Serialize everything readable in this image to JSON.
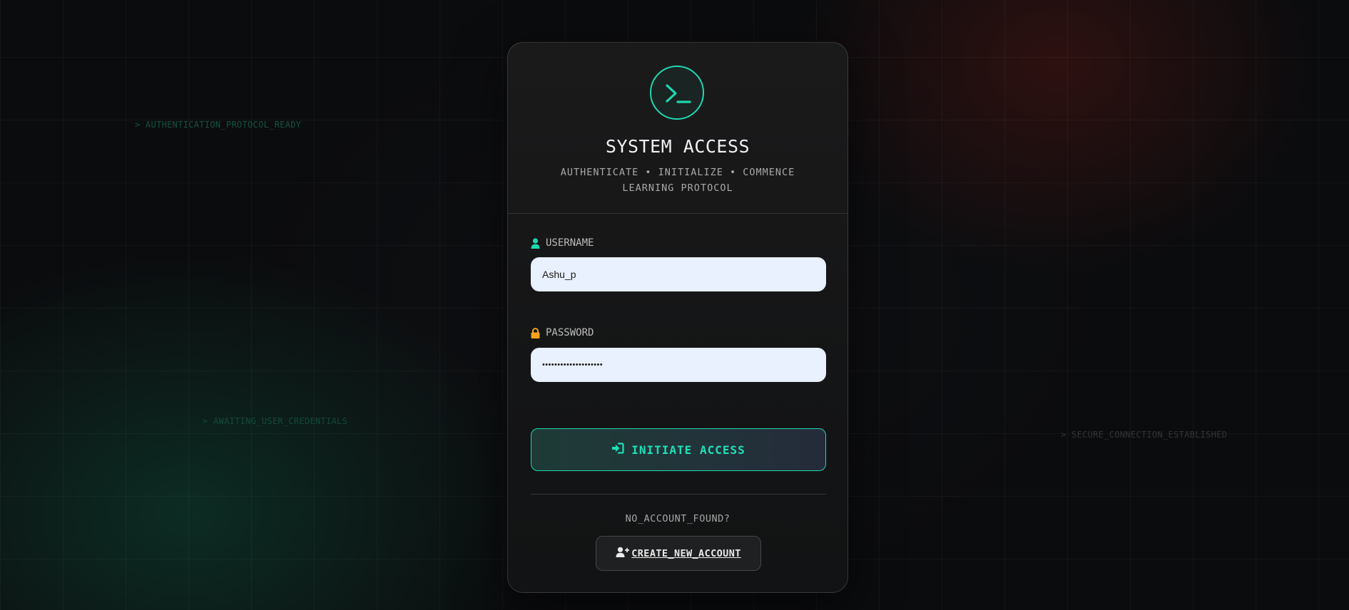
{
  "background": {
    "floating_texts": [
      "> AUTHENTICATION_PROTOCOL_READY",
      "> AWAITING_USER_CREDENTIALS",
      "> SECURE_CONNECTION_ESTABLISHED"
    ]
  },
  "card": {
    "logo_icon": "terminal-prompt-icon",
    "title": "SYSTEM ACCESS",
    "subtitle": "AUTHENTICATE • INITIALIZE • COMMENCE LEARNING PROTOCOL",
    "username": {
      "icon": "user-icon",
      "label": "USERNAME",
      "value": "Ashu_p"
    },
    "password": {
      "icon": "lock-icon",
      "label": "PASSWORD",
      "value": "••••••••••••••••••••"
    },
    "submit": {
      "icon": "sign-in-icon",
      "label": "INITIATE ACCESS"
    },
    "signup_prompt": "NO_ACCOUNT_FOUND?",
    "signup": {
      "icon": "user-plus-icon",
      "label": "CREATE_NEW_ACCOUNT"
    }
  },
  "colors": {
    "accent": "#1fd8b0",
    "lock": "#f5a21a",
    "input_bg": "#e9f0fe"
  }
}
